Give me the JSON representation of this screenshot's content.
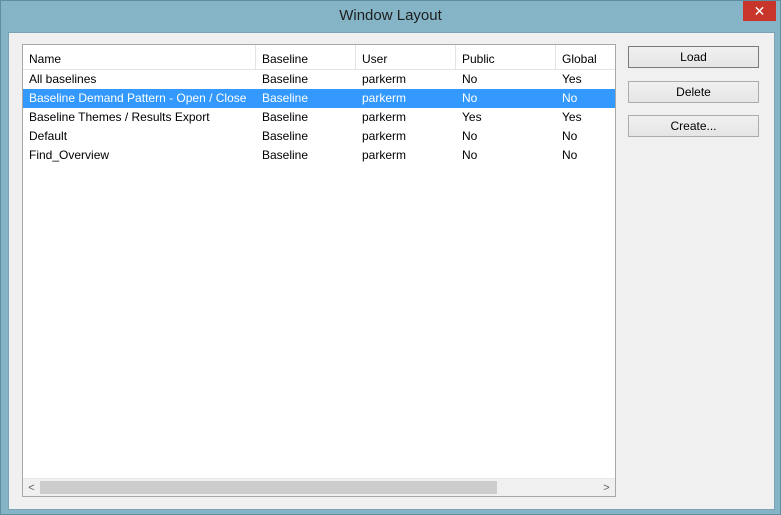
{
  "window": {
    "title": "Window Layout",
    "close_glyph": "✕"
  },
  "list": {
    "columns": [
      "Name",
      "Baseline",
      "User",
      "Public",
      "Global"
    ],
    "rows": [
      {
        "name": "All baselines",
        "baseline": "Baseline",
        "user": "parkerm",
        "public": "No",
        "global": "Yes",
        "selected": false
      },
      {
        "name": "Baseline Demand Pattern - Open / Close",
        "baseline": "Baseline",
        "user": "parkerm",
        "public": "No",
        "global": "No",
        "selected": true
      },
      {
        "name": "Baseline Themes / Results Export",
        "baseline": "Baseline",
        "user": "parkerm",
        "public": "Yes",
        "global": "Yes",
        "selected": false
      },
      {
        "name": "Default",
        "baseline": "Baseline",
        "user": "parkerm",
        "public": "No",
        "global": "No",
        "selected": false
      },
      {
        "name": "Find_Overview",
        "baseline": "Baseline",
        "user": "parkerm",
        "public": "No",
        "global": "No",
        "selected": false
      }
    ],
    "scroll_left_glyph": "<",
    "scroll_right_glyph": ">",
    "selection_color": "#3399ff"
  },
  "buttons": {
    "load": "Load",
    "delete": "Delete",
    "create": "Create..."
  }
}
